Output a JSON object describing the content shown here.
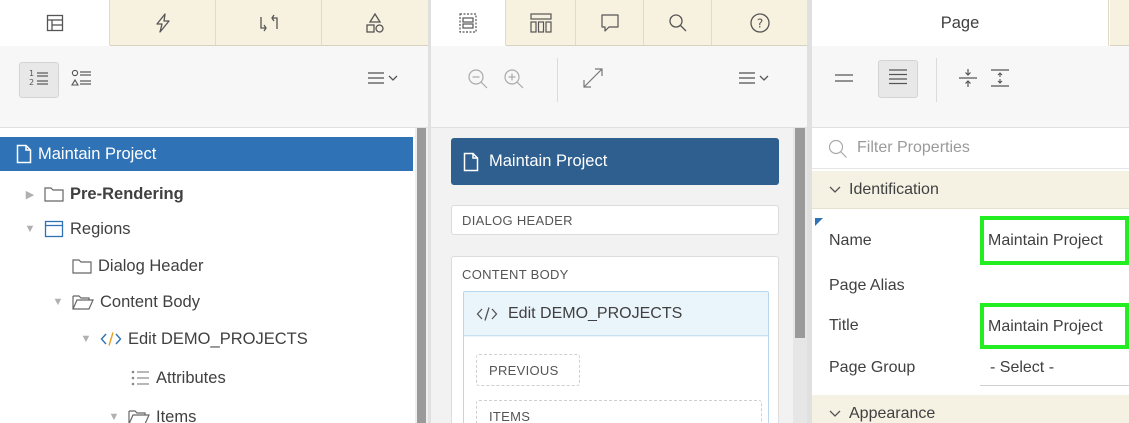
{
  "left_pane": {
    "tabs": [
      {
        "icon": "rendering-tree-icon",
        "active": true
      },
      {
        "icon": "lightning-icon",
        "active": false
      },
      {
        "icon": "processing-icon",
        "active": false
      },
      {
        "icon": "shared-components-icon",
        "active": false
      }
    ],
    "toolbar": {
      "view_by_order_icon": "numbered-list-icon",
      "view_by_type_icon": "shapes-list-icon",
      "menu_icon": "hamburger-menu-icon"
    },
    "tree": [
      {
        "label": "Maintain Project",
        "icon": "page-icon",
        "selected": true
      },
      {
        "label": "Pre-Rendering",
        "icon": "folder-icon",
        "bold": true,
        "toggle": "collapsed"
      },
      {
        "label": "Regions",
        "icon": "region-icon",
        "toggle": "expanded"
      },
      {
        "label": "Dialog Header",
        "icon": "folder-icon"
      },
      {
        "label": "Content Body",
        "icon": "folder-open-icon",
        "toggle": "expanded"
      },
      {
        "label": "Edit DEMO_PROJECTS",
        "icon": "code-icon",
        "toggle": "expanded"
      },
      {
        "label": "Attributes",
        "icon": "attributes-list-icon"
      },
      {
        "label": "Items",
        "icon": "folder-open-icon",
        "toggle": "expanded"
      }
    ]
  },
  "middle_pane": {
    "tabs": [
      {
        "icon": "layout-icon",
        "active": true
      },
      {
        "icon": "gallery-icon",
        "active": false
      },
      {
        "icon": "comment-icon",
        "active": false
      },
      {
        "icon": "search-icon",
        "active": false
      },
      {
        "icon": "help-icon",
        "active": false
      }
    ],
    "page_title": "Maintain Project",
    "dialog_header": "DIALOG HEADER",
    "content_body": "CONTENT BODY",
    "region_title": "Edit DEMO_PROJECTS",
    "slot_previous": "PREVIOUS",
    "slot_items": "ITEMS"
  },
  "right_pane": {
    "tab_label": "Page",
    "filter_placeholder": "Filter Properties",
    "sections": [
      {
        "title": "Identification",
        "properties": [
          {
            "label": "Name",
            "value": "Maintain Project",
            "highlighted": true
          },
          {
            "label": "Page Alias",
            "value": ""
          },
          {
            "label": "Title",
            "value": "Maintain Project",
            "highlighted": true
          },
          {
            "label": "Page Group",
            "value": "- Select -"
          }
        ]
      },
      {
        "title": "Appearance"
      }
    ]
  },
  "colors": {
    "selection_blue": "#2f72b5",
    "card_blue": "#2e5f8e",
    "tab_beige": "#f7f1df",
    "highlight_green": "#22ee22"
  }
}
